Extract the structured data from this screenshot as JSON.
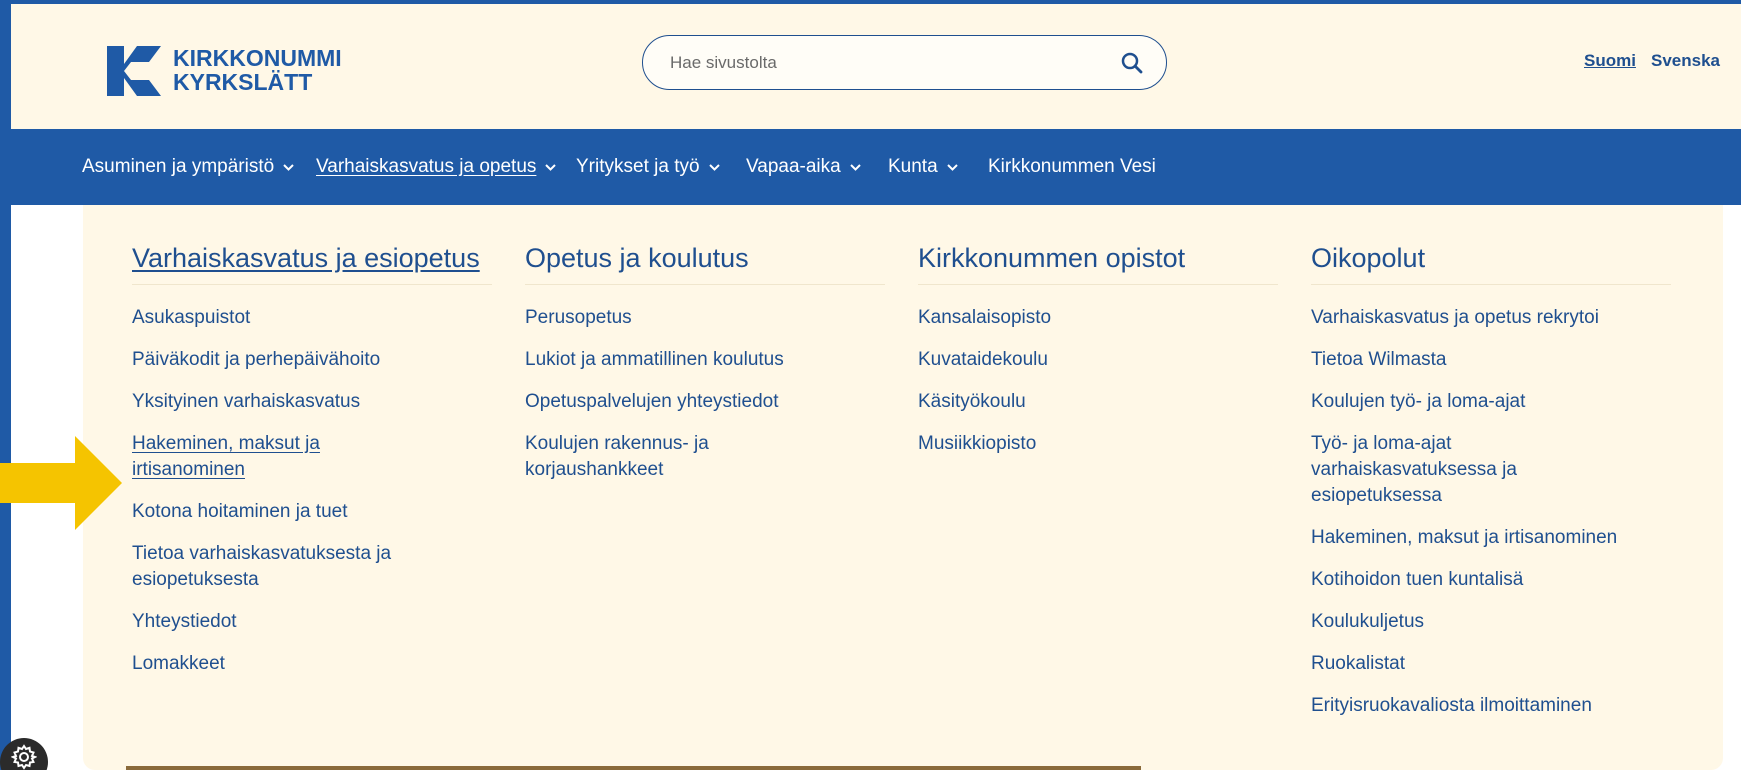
{
  "header": {
    "logo_line1": "KIRKKONUMMI",
    "logo_line2": "KYRKSLÄTT",
    "search_placeholder": "Hae sivustolta",
    "lang_fi": "Suomi",
    "lang_sv": "Svenska"
  },
  "nav": {
    "items": [
      {
        "label": "Asuminen ja ympäristö",
        "has_dropdown": true
      },
      {
        "label": "Varhaiskasvatus ja opetus",
        "has_dropdown": true,
        "active": true
      },
      {
        "label": "Yritykset ja työ",
        "has_dropdown": true
      },
      {
        "label": "Vapaa-aika",
        "has_dropdown": true
      },
      {
        "label": "Kunta",
        "has_dropdown": true
      },
      {
        "label": "Kirkkonummen Vesi",
        "has_dropdown": false
      }
    ]
  },
  "mega_menu": {
    "columns": [
      {
        "heading": "Varhaiskasvatus ja esiopetus",
        "items": [
          "Asukaspuistot",
          "Päiväkodit ja perhepäivähoito",
          "Yksityinen varhaiskasvatus",
          "Hakeminen, maksut ja irtisanominen",
          "Kotona hoitaminen ja tuet",
          "Tietoa varhaiskasvatuksesta ja esiopetuksesta",
          "Yhteystiedot",
          "Lomakkeet"
        ]
      },
      {
        "heading": "Opetus ja koulutus",
        "items": [
          "Perusopetus",
          "Lukiot ja ammatillinen koulutus",
          "Opetuspalvelujen yhteystiedot",
          "Koulujen rakennus- ja korjaushankkeet"
        ]
      },
      {
        "heading": "Kirkkonummen opistot",
        "items": [
          "Kansalaisopisto",
          "Kuvataidekoulu",
          "Käsityökoulu",
          "Musiikkiopisto"
        ]
      },
      {
        "heading": "Oikopolut",
        "items": [
          "Varhaiskasvatus ja opetus rekrytoi",
          "Tietoa Wilmasta",
          "Koulujen työ- ja loma-ajat",
          "Työ- ja loma-ajat varhaiskasvatuksessa ja esiopetuksessa",
          "Hakeminen, maksut ja irtisanominen",
          "Kotihoidon tuen kuntalisä",
          "Koulukuljetus",
          "Ruokalistat",
          "Erityisruokavaliosta ilmoittaminen"
        ]
      }
    ]
  },
  "icons": {
    "search": "search-icon",
    "chevron": "chevron-down-icon",
    "pointer": "arrow-right-icon",
    "settings": "gear-icon"
  },
  "colors": {
    "brand_blue": "#1f5aa6",
    "text_blue": "#1f4f8f",
    "cream": "#fff8e7",
    "arrow_yellow": "#f5c400"
  }
}
